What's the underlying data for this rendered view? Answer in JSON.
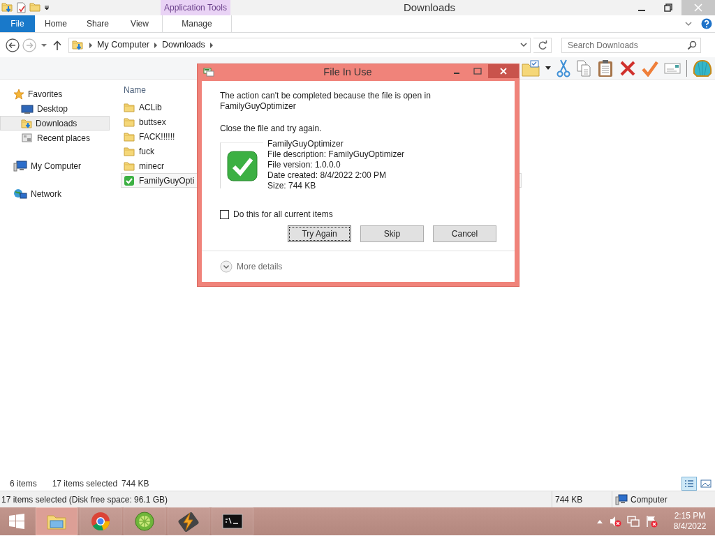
{
  "title_bar": {
    "title": "Downloads",
    "contextual_group": "Application Tools"
  },
  "ribbon_tabs": [
    {
      "label": "File",
      "kind": "file"
    },
    {
      "label": "Home",
      "kind": "tab"
    },
    {
      "label": "Share",
      "kind": "tab"
    },
    {
      "label": "View",
      "kind": "tab"
    },
    {
      "label": "Manage",
      "kind": "contextual"
    }
  ],
  "address_bar": {
    "crumbs": [
      "My Computer",
      "Downloads"
    ]
  },
  "search": {
    "placeholder": "Search Downloads"
  },
  "sidebar": {
    "groups": [
      {
        "label": "Favorites",
        "kind": "favorites",
        "children": [
          {
            "label": "Desktop",
            "kind": "desktop",
            "selected": false
          },
          {
            "label": "Downloads",
            "kind": "downloads",
            "selected": true
          },
          {
            "label": "Recent places",
            "kind": "recent",
            "selected": false
          }
        ]
      },
      {
        "label": "My Computer",
        "kind": "computer"
      },
      {
        "label": "Network",
        "kind": "network"
      }
    ]
  },
  "file_list": {
    "column": "Name",
    "files": [
      {
        "name": "ACLib",
        "kind": "folder",
        "selected": false
      },
      {
        "name": "buttsex",
        "kind": "folder",
        "selected": false
      },
      {
        "name": "FACK!!!!!!",
        "kind": "folder",
        "selected": false
      },
      {
        "name": "fuck",
        "kind": "folder",
        "selected": false
      },
      {
        "name": "minecr",
        "kind": "folder",
        "selected": false
      },
      {
        "name": "FamilyGuyOpti",
        "kind": "app",
        "selected": true
      }
    ]
  },
  "status_bar": {
    "item_count": "6 items",
    "selection": "17 items selected",
    "size": "744 KB"
  },
  "details_bar": {
    "text": "17 items selected (Disk free space: 96.1 GB)",
    "size": "744 KB",
    "location": "Computer"
  },
  "dialog": {
    "title": "File In Use",
    "message": "The action can't be completed because the file is open in FamilyGuyOptimizer",
    "instruction": "Close the file and try again.",
    "file_details": [
      "FamilyGuyOptimizer",
      "File description: FamilyGuyOptimizer",
      "File version: 1.0.0.0",
      "Date created: 8/4/2022 2:00 PM",
      "Size: 744 KB"
    ],
    "checkbox": {
      "label": "Do this for all current items",
      "checked": false
    },
    "buttons": [
      {
        "label": "Try Again",
        "focused": true
      },
      {
        "label": "Skip",
        "focused": false
      },
      {
        "label": "Cancel",
        "focused": false
      }
    ],
    "more_details": "More details"
  },
  "taskbar": {
    "apps": [
      {
        "kind": "explorer",
        "active": true
      },
      {
        "kind": "chrome",
        "active": false
      },
      {
        "kind": "lime",
        "active": false
      },
      {
        "kind": "winamp",
        "active": false
      },
      {
        "kind": "terminal",
        "active": false
      }
    ],
    "clock": {
      "time": "2:15 PM",
      "date": "8/4/2022"
    }
  }
}
